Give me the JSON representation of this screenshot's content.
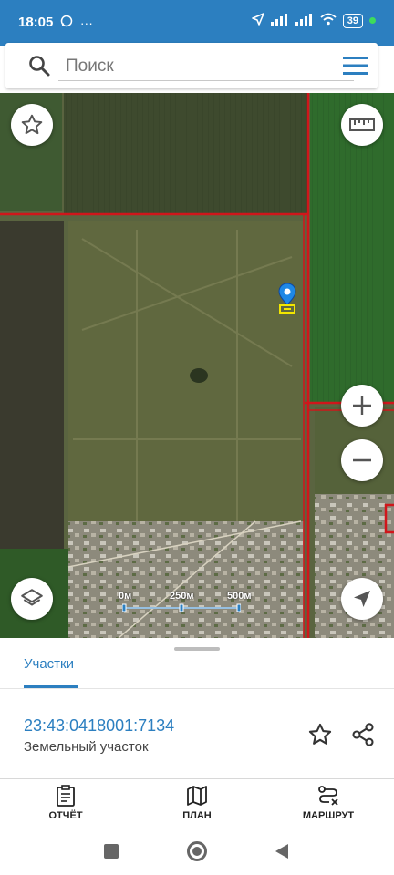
{
  "status_bar": {
    "time": "18:05",
    "left_icons": [
      "whatsapp-icon",
      "more-icon"
    ],
    "right_icons": [
      "location-icon",
      "signal-icon",
      "signal-icon",
      "wifi-icon",
      "battery-icon"
    ],
    "battery": "39"
  },
  "search": {
    "placeholder": "Поиск",
    "icons": [
      "search-icon",
      "menu-icon"
    ]
  },
  "map": {
    "controls": [
      "favorite-star-icon",
      "ruler-icon",
      "zoom-in-icon",
      "zoom-out-icon",
      "layers-icon",
      "navigation-arrow-icon"
    ],
    "scale": {
      "labels": [
        "0м",
        "250м",
        "500м"
      ]
    },
    "marker": "map-pin-icon",
    "colors": {
      "parcel_border": "#d0161b",
      "marker_blue": "#1e88e5",
      "marker_yellow": "#f2e600"
    }
  },
  "sheet": {
    "tab": "Участки",
    "cadastral_number": "23:43:0418001:7134",
    "type": "Земельный участок"
  },
  "bottom_nav": {
    "items": [
      {
        "label": "ОТЧЁТ",
        "icon": "report-icon"
      },
      {
        "label": "ПЛАН",
        "icon": "map-plan-icon"
      },
      {
        "label": "МАРШРУТ",
        "icon": "route-icon"
      }
    ]
  },
  "theme": {
    "accent": "#2c7fc0"
  }
}
